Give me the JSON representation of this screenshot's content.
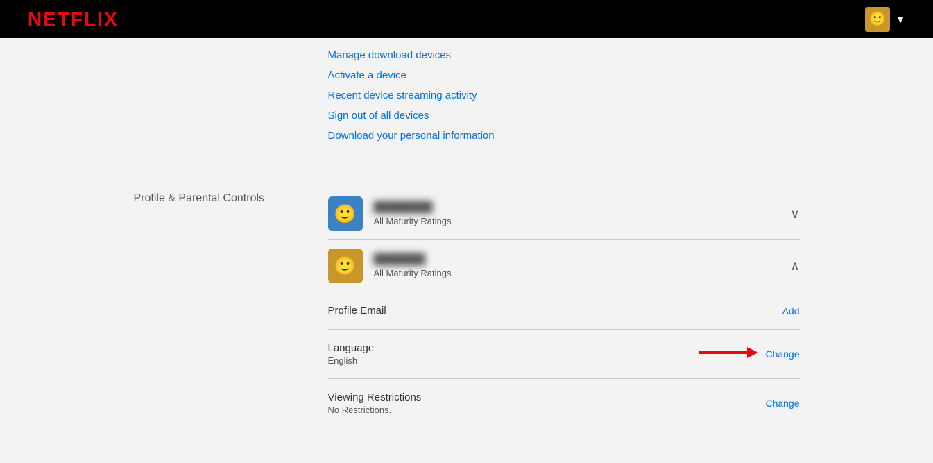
{
  "header": {
    "logo": "NETFLIX",
    "avatar_emoji": "🙂",
    "dropdown_arrow": "▼"
  },
  "top_links": {
    "link1": "Manage download devices",
    "link2": "Activate a device",
    "link3": "Recent device streaming activity",
    "link4": "Sign out of all devices",
    "link5": "Download your personal information"
  },
  "section": {
    "label": "Profile & Parental Controls"
  },
  "profiles": [
    {
      "id": "profile1",
      "color": "blue",
      "name": "●●●●●●●●●",
      "rating": "All Maturity Ratings",
      "chevron": "∨",
      "expanded": false
    },
    {
      "id": "profile2",
      "color": "yellow",
      "name": "●●●●●●●",
      "rating": "All Maturity Ratings",
      "chevron": "∧",
      "expanded": true
    }
  ],
  "profile_details": [
    {
      "id": "profile-email",
      "title": "Profile Email",
      "value": "",
      "action": "Add"
    },
    {
      "id": "language",
      "title": "Language",
      "value": "English",
      "action": "Change",
      "has_arrow": true
    },
    {
      "id": "viewing-restrictions",
      "title": "Viewing Restrictions",
      "value": "No Restrictions.",
      "action": "Change"
    }
  ]
}
